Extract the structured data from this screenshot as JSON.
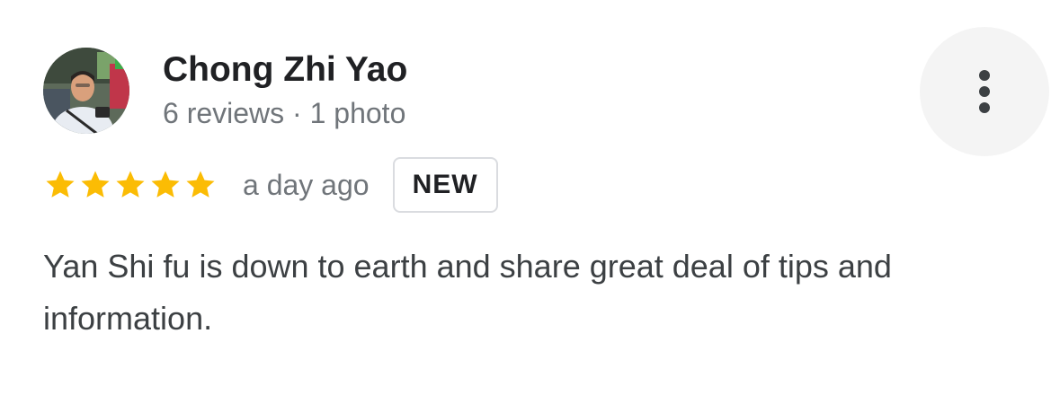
{
  "reviewer": {
    "name": "Chong Zhi Yao",
    "meta": "6 reviews · 1 photo",
    "avatar_icon": "reviewer-photo"
  },
  "rating": {
    "stars": 5,
    "max_stars": 5,
    "star_color": "#fbbc04",
    "time": "a day ago",
    "badge": "NEW"
  },
  "review": {
    "text": "Yan Shi fu is down to earth and share great deal of tips and information."
  },
  "actions": {
    "more_icon": "more-vert-icon"
  },
  "colors": {
    "name": "#202124",
    "meta": "#70757a",
    "body": "#3c4043",
    "more_button_bg": "#f4f4f4",
    "badge_border": "#dadce0"
  }
}
